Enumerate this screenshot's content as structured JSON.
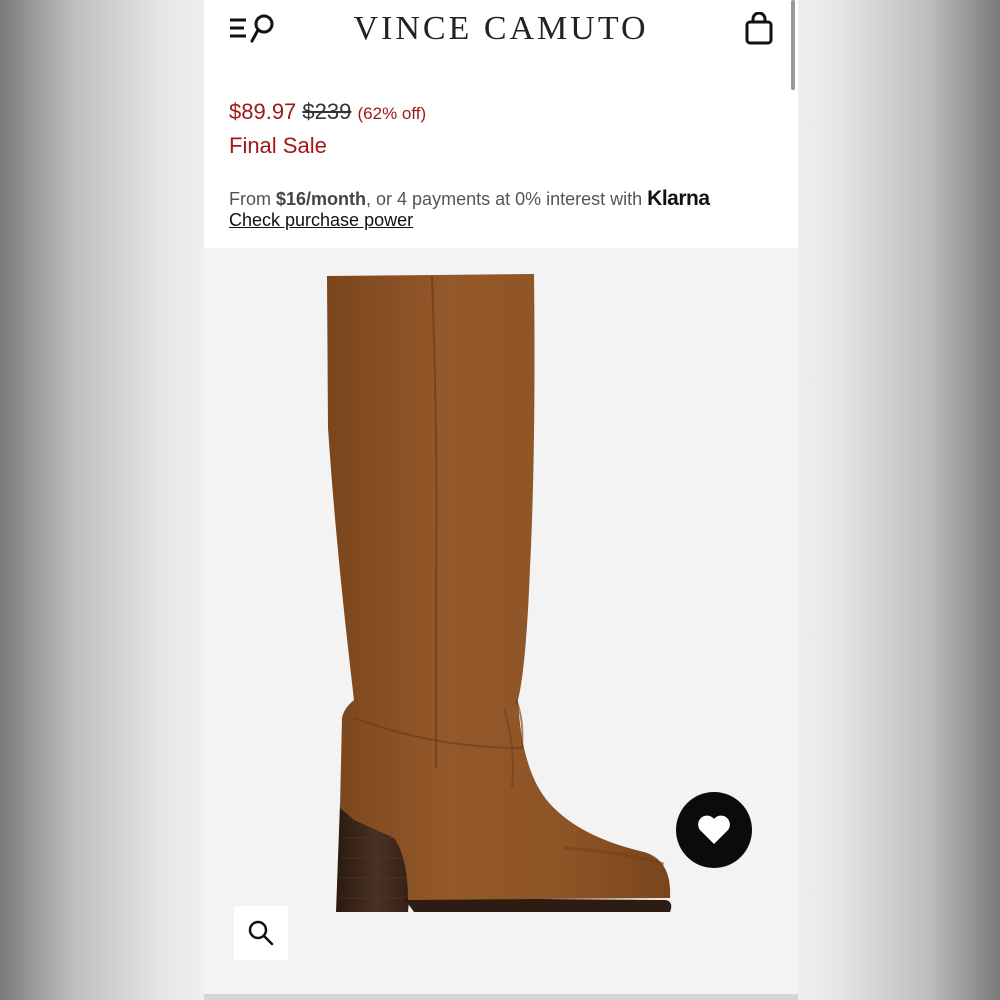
{
  "header": {
    "brand": "VINCE CAMUTO",
    "menu_icon": "menu-search-icon",
    "bag_icon": "shopping-bag-icon"
  },
  "pricing": {
    "sale_price": "$89.97",
    "original_price": "$239",
    "discount": "(62% off)",
    "final_sale": "Final Sale"
  },
  "klarna": {
    "prefix": "From ",
    "monthly": "$16/month",
    "middle": ", or 4 payments at 0% interest with ",
    "logo_text": "Klarna",
    "link": "Check purchase power"
  },
  "product_image": {
    "alt": "brown suede knee-high boot with block heel",
    "heart_icon": "heart-icon",
    "zoom_icon": "zoom-icon"
  },
  "colors": {
    "sale_red": "#a01818",
    "boot_brown": "#8a5224",
    "heel_dark": "#3a2418"
  }
}
